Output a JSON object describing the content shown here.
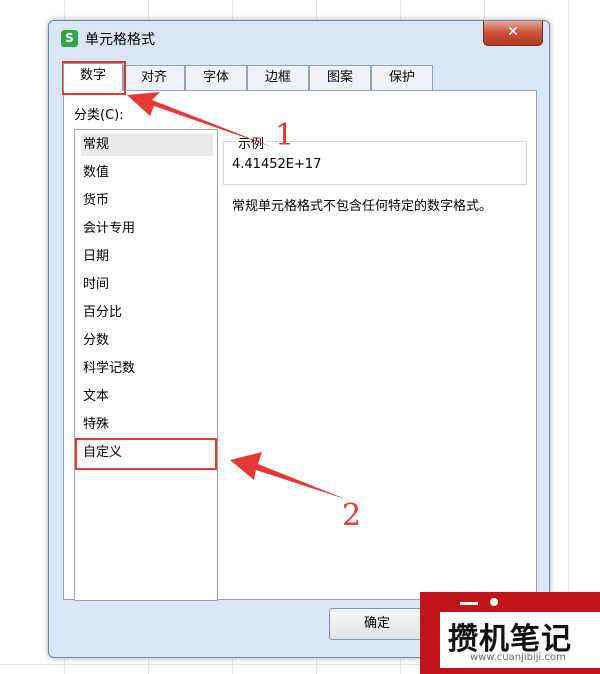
{
  "dialog": {
    "title": "单元格格式",
    "app_icon_glyph": "S",
    "close_glyph": "✕"
  },
  "tabs": [
    {
      "label": "数字",
      "active": true
    },
    {
      "label": "对齐"
    },
    {
      "label": "字体"
    },
    {
      "label": "边框"
    },
    {
      "label": "图案"
    },
    {
      "label": "保护"
    }
  ],
  "category": {
    "label": "分类(C):",
    "items": [
      "常规",
      "数值",
      "货币",
      "会计专用",
      "日期",
      "时间",
      "百分比",
      "分数",
      "科学记数",
      "文本",
      "特殊",
      "自定义"
    ],
    "selected": "常规"
  },
  "example": {
    "label": "示例",
    "value": "4.41452E+17"
  },
  "description": "常规单元格格式不包含任何特定的数字格式。",
  "buttons": {
    "ok": "确定"
  },
  "annotations": {
    "num1": "1",
    "num2": "2",
    "color": "#e53935"
  },
  "watermark": {
    "text": "攒机笔记",
    "url": "www.cuanjibiji.com",
    "color": "#c0141b"
  }
}
